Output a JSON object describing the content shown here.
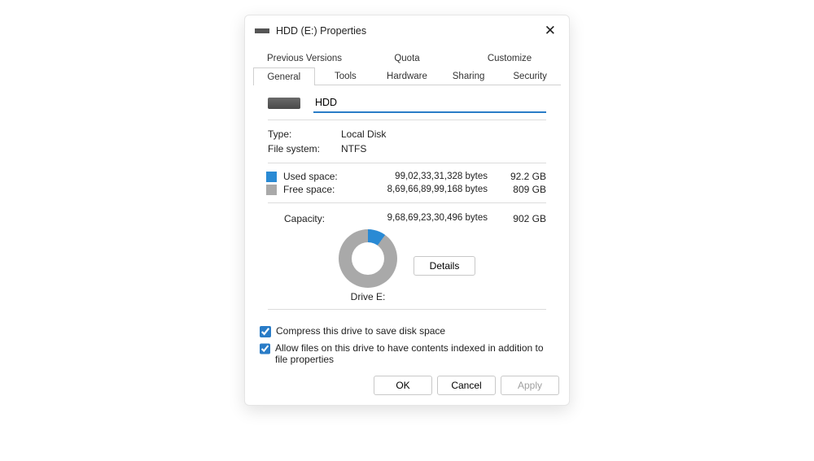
{
  "window": {
    "title": "HDD (E:) Properties"
  },
  "tabs": {
    "row1": [
      "Previous Versions",
      "Quota",
      "Customize"
    ],
    "row2": [
      "General",
      "Tools",
      "Hardware",
      "Sharing",
      "Security"
    ],
    "active": "General"
  },
  "drive": {
    "name_value": "HDD",
    "type_label": "Type:",
    "type_value": "Local Disk",
    "fs_label": "File system:",
    "fs_value": "NTFS",
    "used_label": "Used space:",
    "used_bytes": "99,02,33,31,328 bytes",
    "used_human": "92.2 GB",
    "free_label": "Free space:",
    "free_bytes": "8,69,66,89,99,168 bytes",
    "free_human": "809 GB",
    "capacity_label": "Capacity:",
    "capacity_bytes": "9,68,69,23,30,496 bytes",
    "capacity_human": "902 GB",
    "drive_letter_label": "Drive E:",
    "details_label": "Details"
  },
  "checks": {
    "compress": "Compress this drive to save disk space",
    "index": "Allow files on this drive to have contents indexed in addition to file properties"
  },
  "buttons": {
    "ok": "OK",
    "cancel": "Cancel",
    "apply": "Apply"
  },
  "chart_data": {
    "type": "pie",
    "title": "Drive E:",
    "series": [
      {
        "name": "Used space",
        "value": 92.2,
        "unit": "GB",
        "color": "#2a8ad4"
      },
      {
        "name": "Free space",
        "value": 809,
        "unit": "GB",
        "color": "#a9a9a9"
      }
    ]
  }
}
